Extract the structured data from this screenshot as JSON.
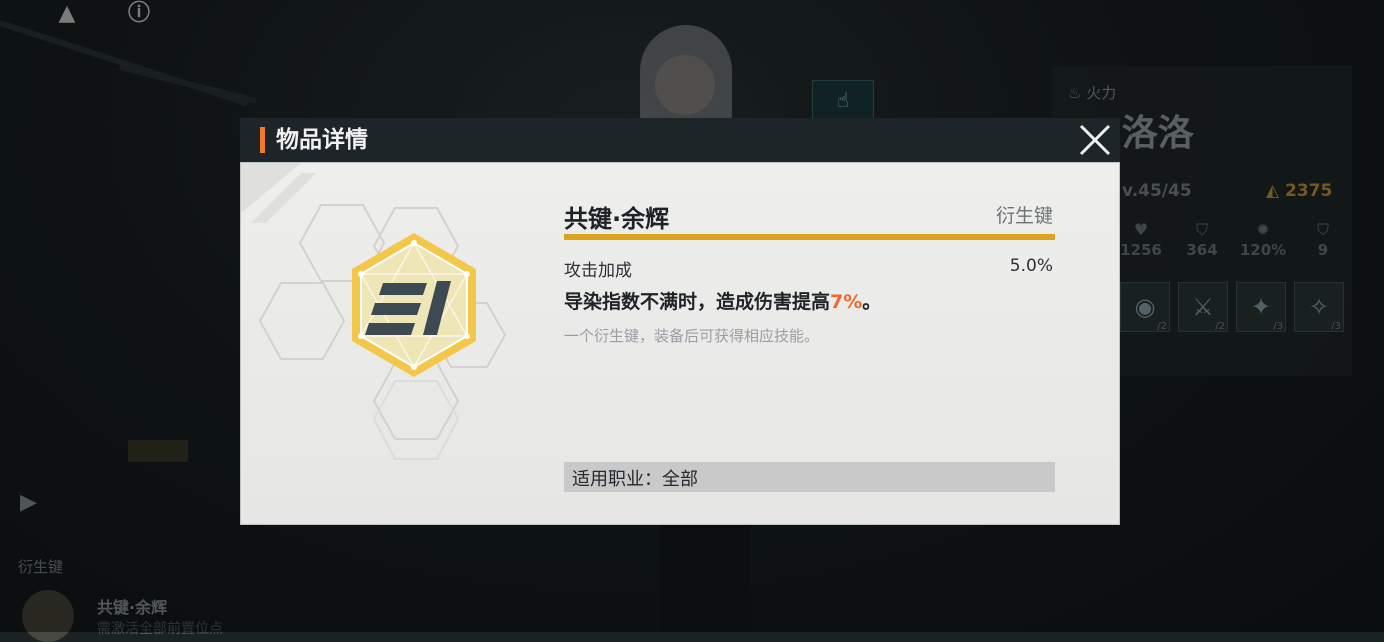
{
  "modal": {
    "title": "物品详情",
    "item_name": "共键·余辉",
    "item_type": "衍生键",
    "stat_label": "攻击加成",
    "stat_value": "5.0%",
    "effect_prefix": "导染指数不满时，造成伤害提高",
    "effect_highlight": "7%",
    "effect_suffix": "。",
    "description": "一个衍生键，装备后可获得相应技能。",
    "job_label": "适用职业：",
    "job_value": "全部",
    "colors": {
      "accent": "#ef7a2a",
      "highlight": "#ef6a2a",
      "bar": "#dca41a"
    }
  },
  "background": {
    "character": {
      "attribute": "火力",
      "name": "[?]洛洛",
      "level": "v.45/45",
      "power": "2375",
      "stats": [
        "1256",
        "364",
        "120%",
        "9"
      ],
      "skill_counts": [
        "/2",
        "/2",
        "/3",
        "/3"
      ]
    },
    "bottom_left": {
      "category": "衍生键",
      "item_name": "共键·余辉",
      "item_sub": "需激活全部前置位点"
    }
  }
}
